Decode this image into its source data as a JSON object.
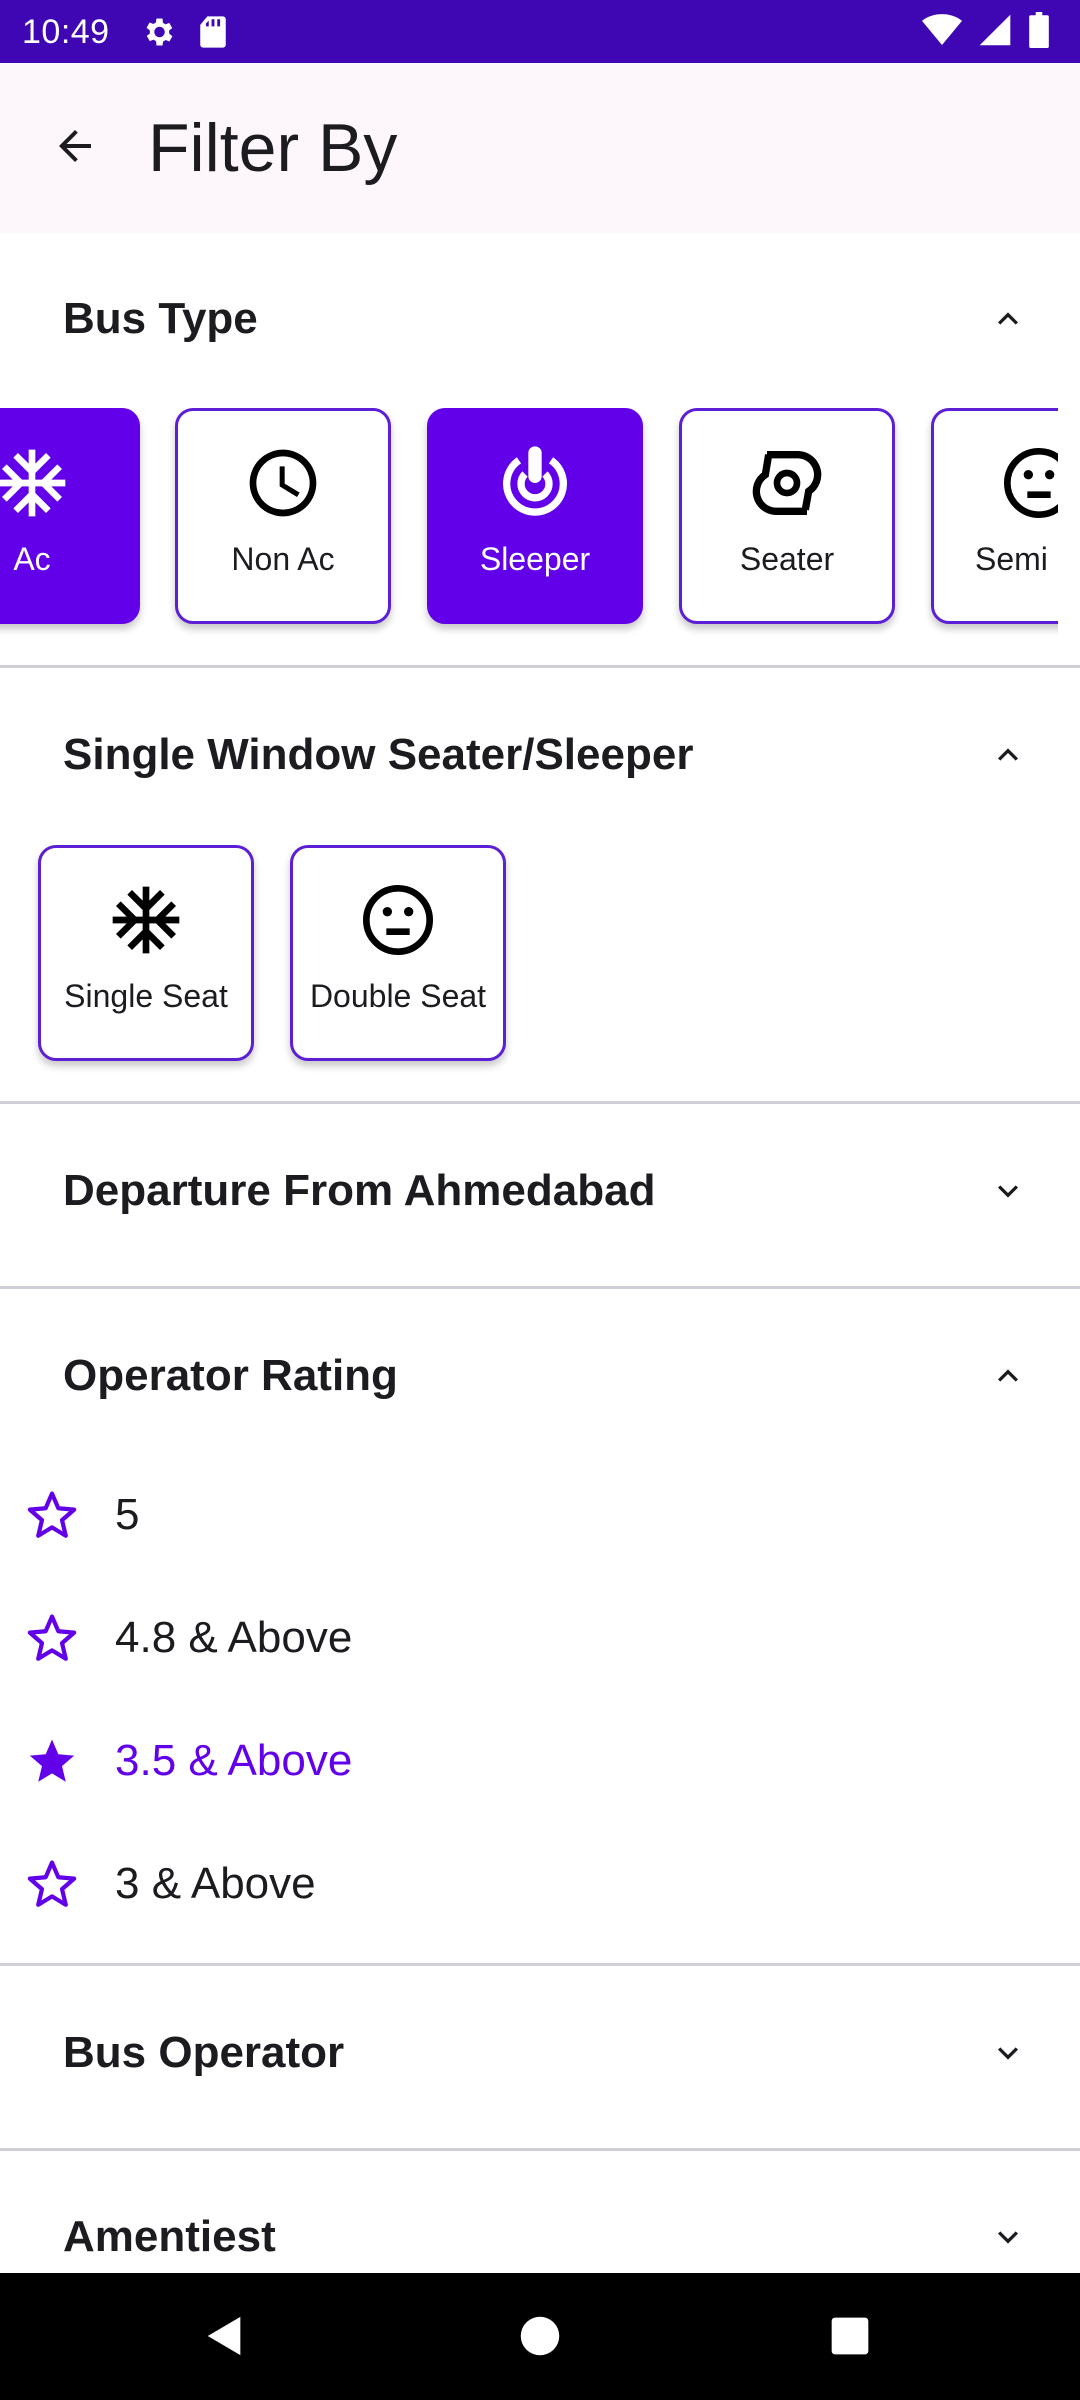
{
  "status_bar": {
    "time": "10:49",
    "icons": [
      "gear-icon",
      "sd-card-icon",
      "wifi-icon",
      "signal-icon",
      "battery-icon"
    ]
  },
  "app_bar": {
    "title": "Filter By",
    "back_icon": "arrow-back-icon"
  },
  "sections": {
    "bus_type": {
      "title": "Bus Type",
      "expanded": true,
      "chips": [
        {
          "label": "Ac",
          "icon": "snowflake-icon",
          "selected": true
        },
        {
          "label": "Non Ac",
          "icon": "clock-icon",
          "selected": false
        },
        {
          "label": "Sleeper",
          "icon": "sleeper-icon",
          "selected": true
        },
        {
          "label": "Seater",
          "icon": "seat-icon",
          "selected": false
        },
        {
          "label": "Semi Sle",
          "icon": "neutral-face-icon",
          "selected": false
        }
      ]
    },
    "single_window": {
      "title": "Single Window Seater/Sleeper",
      "expanded": true,
      "chips": [
        {
          "label": "Single Seat",
          "icon": "asterisk-icon",
          "selected": false
        },
        {
          "label": "Double Seat",
          "icon": "neutral-face-icon",
          "selected": false
        }
      ]
    },
    "departure": {
      "title": "Departure From Ahmedabad",
      "expanded": false
    },
    "operator_rating": {
      "title": "Operator Rating",
      "expanded": true,
      "options": [
        {
          "label": "5",
          "selected": false
        },
        {
          "label": "4.8 & Above",
          "selected": false
        },
        {
          "label": "3.5 & Above",
          "selected": true
        },
        {
          "label": "3 & Above",
          "selected": false
        }
      ]
    },
    "bus_operator": {
      "title": "Bus Operator",
      "expanded": false
    },
    "amenities": {
      "title": "Amentiest",
      "expanded": false
    }
  },
  "colors": {
    "primary": "#6200ea",
    "status_bar": "#3f07b4",
    "app_bar_bg": "#fdf7fc",
    "divider": "#d0ced6"
  }
}
